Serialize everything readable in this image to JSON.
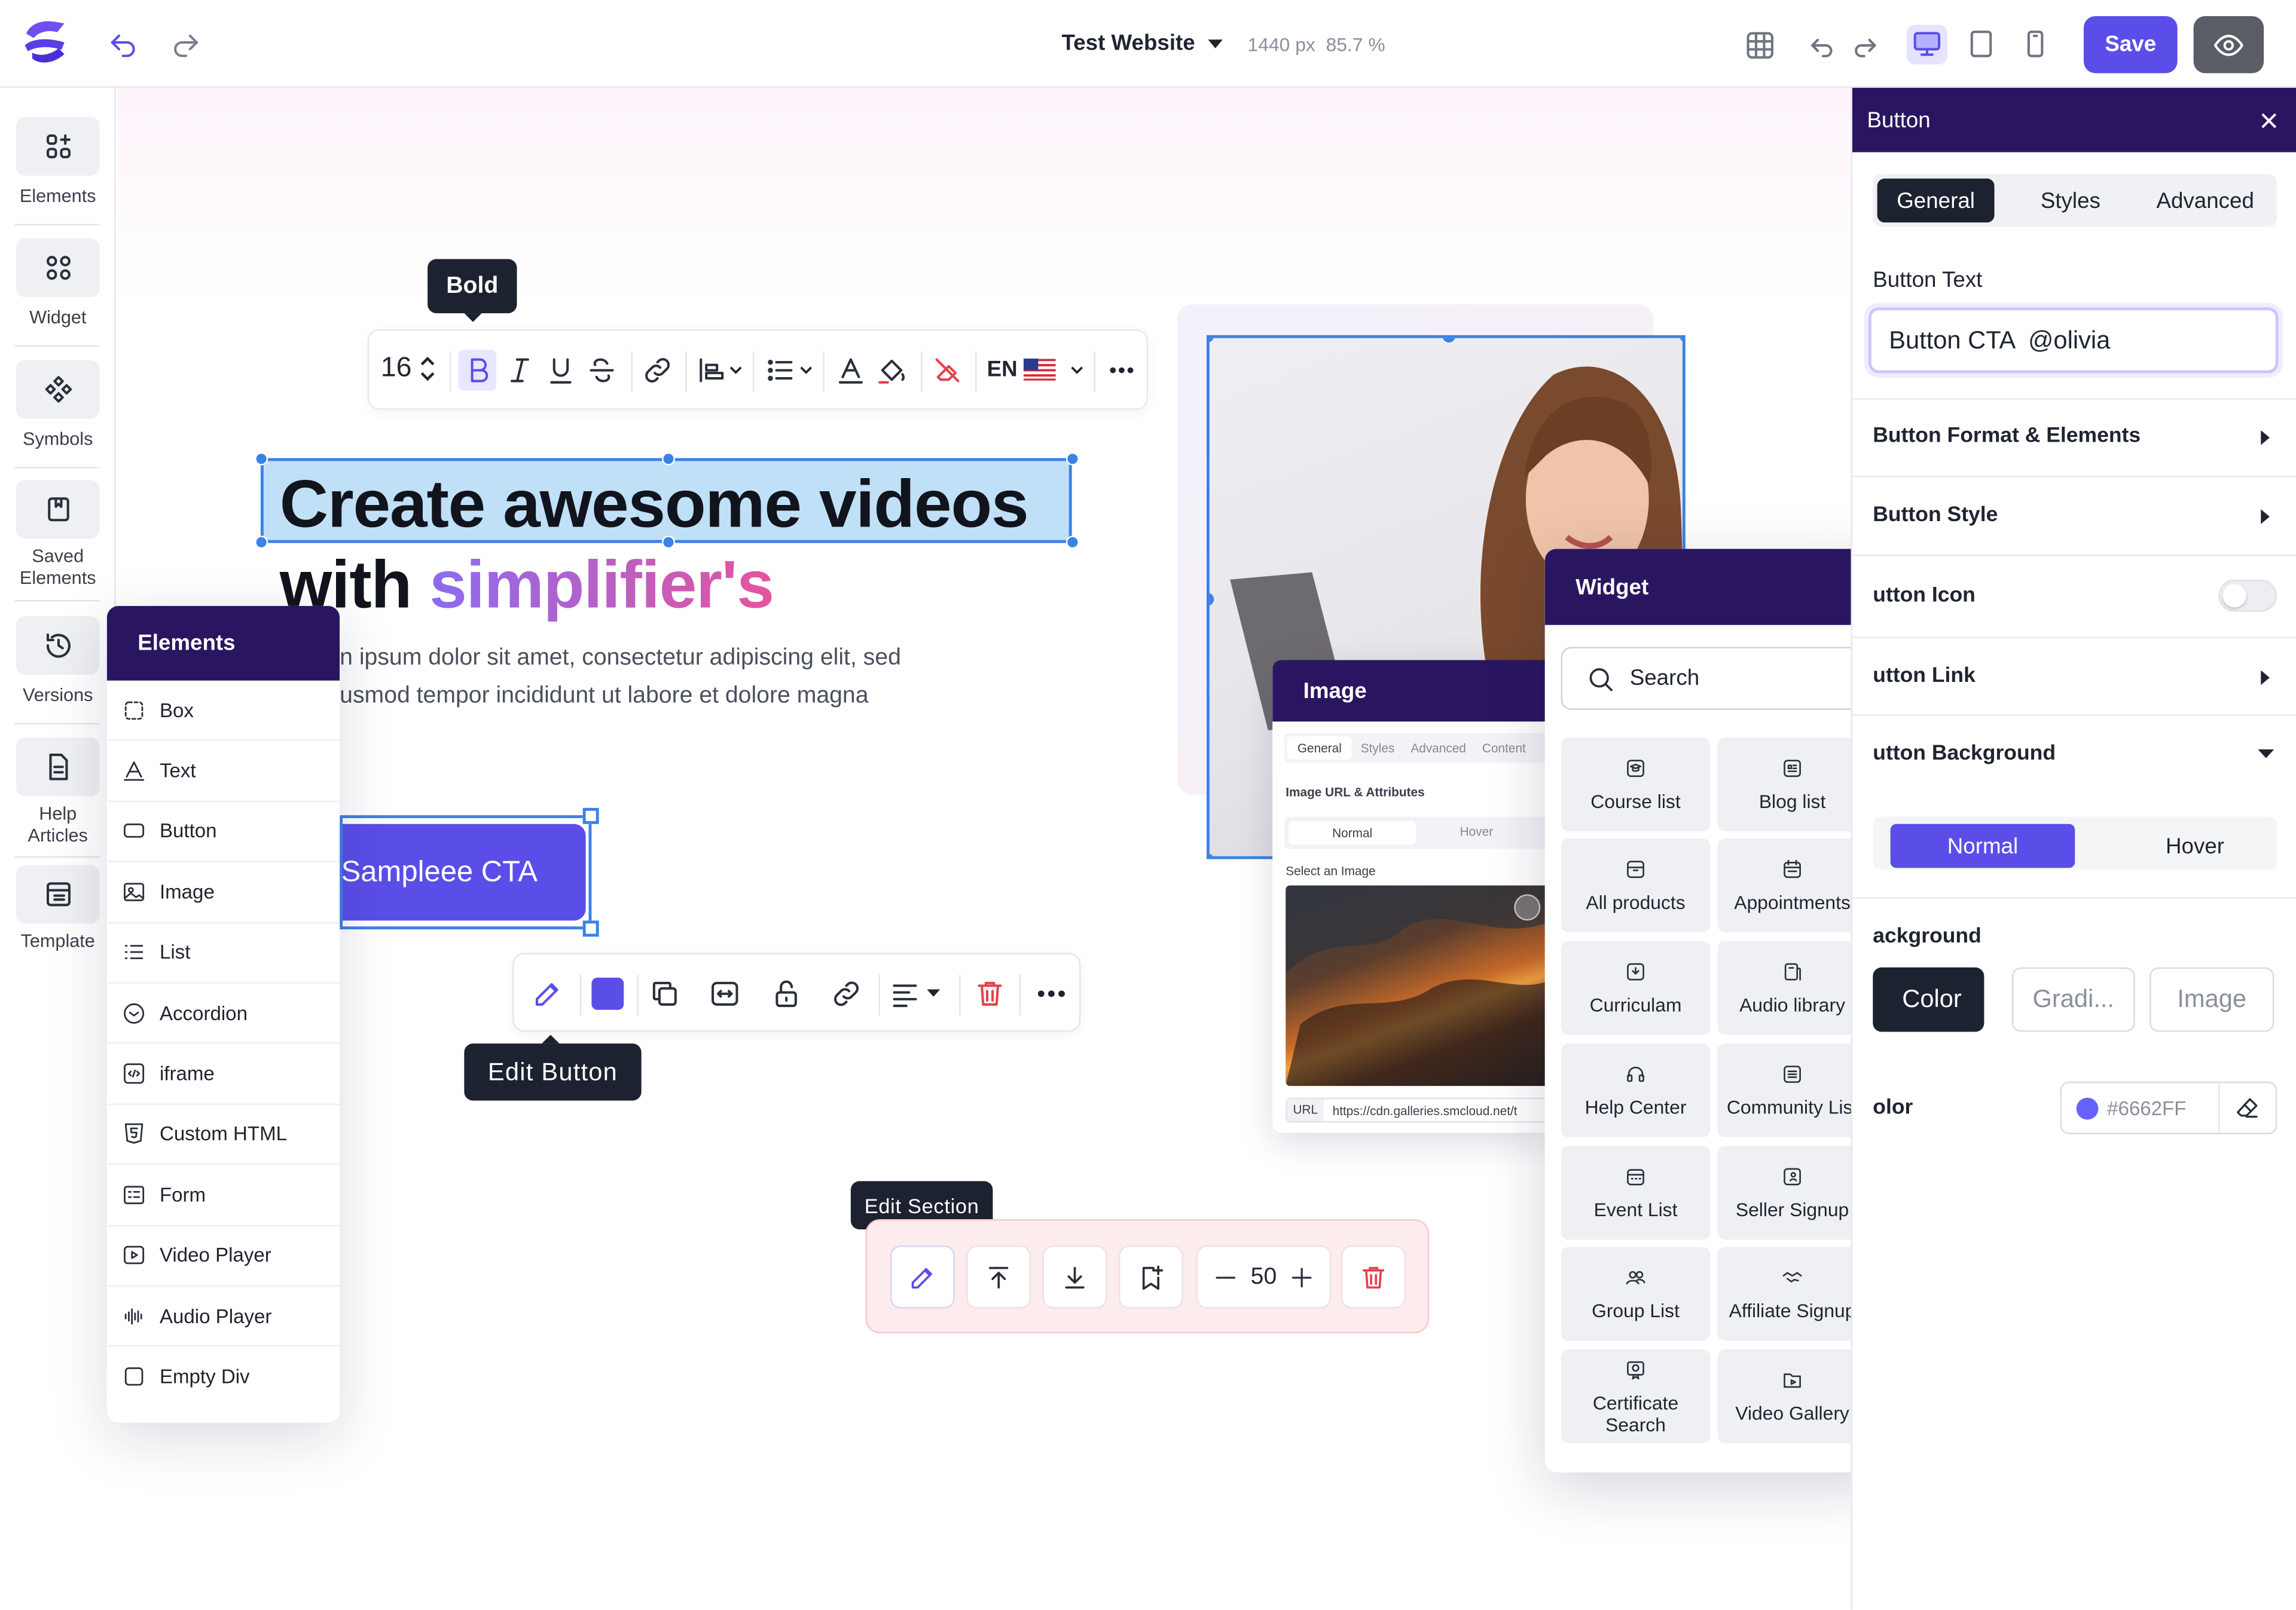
{
  "topbar": {
    "site_name": "Test Website",
    "viewport": "1440 px",
    "zoom": "85.7 %",
    "save_label": "Save",
    "icons": [
      "logo-icon",
      "undo-icon",
      "redo-icon",
      "chevron-down-icon",
      "grid-icon",
      "undo-icon",
      "redo-icon",
      "desktop-icon",
      "tablet-icon",
      "mobile-icon",
      "eye-icon"
    ]
  },
  "left_rail": {
    "items": [
      {
        "label": "Elements",
        "icon": "elements-icon"
      },
      {
        "label": "Widget",
        "icon": "widget-icon"
      },
      {
        "label": "Symbols",
        "icon": "symbols-icon"
      },
      {
        "label": "Saved Elements",
        "icon": "bookmark-icon"
      },
      {
        "label": "Versions",
        "icon": "history-icon"
      },
      {
        "label": "Help Articles",
        "icon": "document-icon"
      },
      {
        "label": "Template",
        "icon": "template-icon"
      }
    ]
  },
  "text_toolbar": {
    "tooltip": "Bold",
    "font_size": "16",
    "language": "EN"
  },
  "canvas": {
    "headline_line1": "Create awesome videos",
    "headline_line2_a": "with ",
    "headline_line2_b": "simplifier's",
    "paragraph_line1": "n ipsum dolor sit amet, consectetur adipiscing elit, sed",
    "paragraph_line2": "usmod tempor incididunt ut labore et dolore magna",
    "cta_label": "Sampleee CTA",
    "edit_button_tooltip": "Edit Button",
    "edit_section_tooltip": "Edit Section",
    "section_spacing": "50",
    "accent_color": "#5B4EE8"
  },
  "elements_panel": {
    "title": "Elements",
    "items": [
      {
        "label": "Box",
        "icon": "box-icon"
      },
      {
        "label": "Text",
        "icon": "text-icon"
      },
      {
        "label": "Button",
        "icon": "button-icon"
      },
      {
        "label": "Image",
        "icon": "image-icon"
      },
      {
        "label": "List",
        "icon": "list-icon"
      },
      {
        "label": "Accordion",
        "icon": "accordion-icon"
      },
      {
        "label": "iframe",
        "icon": "iframe-icon"
      },
      {
        "label": "Custom HTML",
        "icon": "html-icon"
      },
      {
        "label": "Form",
        "icon": "form-icon"
      },
      {
        "label": "Video Player",
        "icon": "video-icon"
      },
      {
        "label": "Audio Player",
        "icon": "audio-icon"
      },
      {
        "label": "Empty Div",
        "icon": "div-icon"
      }
    ]
  },
  "image_panel": {
    "title": "Image",
    "tabs": [
      "General",
      "Styles",
      "Advanced",
      "Content"
    ],
    "section": "Image URL & Attributes",
    "states": [
      "Normal",
      "Hover"
    ],
    "select_label": "Select an Image",
    "url_label": "URL",
    "url_value": "https://cdn.galleries.smcloud.net/t"
  },
  "widget_panel": {
    "title": "Widget",
    "search_placeholder": "Search",
    "cards": [
      {
        "label": "Course list",
        "icon": "course-icon"
      },
      {
        "label": "Blog list",
        "icon": "blog-icon"
      },
      {
        "label": "All products",
        "icon": "products-icon"
      },
      {
        "label": "Appointments",
        "icon": "calendar-icon"
      },
      {
        "label": "Curriculam",
        "icon": "curriculum-icon"
      },
      {
        "label": "Audio library",
        "icon": "audio-library-icon"
      },
      {
        "label": "Help Center",
        "icon": "headset-icon"
      },
      {
        "label": "Community List",
        "icon": "community-icon"
      },
      {
        "label": "Event List",
        "icon": "event-icon"
      },
      {
        "label": "Seller Signup",
        "icon": "seller-icon"
      },
      {
        "label": "Group List",
        "icon": "group-icon"
      },
      {
        "label": "Affiliate Signup",
        "icon": "handshake-icon"
      },
      {
        "label": "Certificate Search",
        "icon": "certificate-icon"
      },
      {
        "label": "Video Gallery",
        "icon": "video-gallery-icon"
      }
    ]
  },
  "props_panel": {
    "title": "Button",
    "tabs": [
      "General",
      "Styles",
      "Advanced"
    ],
    "button_text_label": "Button Text",
    "button_text_value": "Button CTA  @olivia",
    "sections": [
      "Button Format & Elements",
      "Button Style",
      "utton Icon",
      "utton Link",
      "utton Background"
    ],
    "states": [
      "Normal",
      "Hover"
    ],
    "background_label": "ackground",
    "bg_types": [
      "Color",
      "Gradi...",
      "Image"
    ],
    "color_label": "olor",
    "color_value": "#6662FF",
    "icon_toggle_on": false
  }
}
